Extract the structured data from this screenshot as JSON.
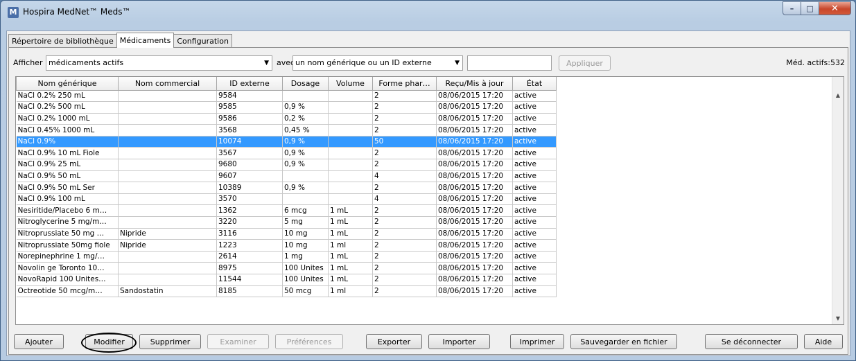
{
  "window": {
    "title": "Hospira MedNet™ Meds™",
    "app_icon": "M"
  },
  "window_controls": {
    "minimize_icon": "–",
    "maximize_icon": "□",
    "close_icon": "✕"
  },
  "tabs": [
    {
      "label": "Répertoire de bibliothèque"
    },
    {
      "label": "Médicaments"
    },
    {
      "label": "Configuration"
    }
  ],
  "filter": {
    "show_label": "Afficher",
    "show_value": "médicaments actifs",
    "with_label": "avec",
    "with_value": "un nom générique ou un ID externe",
    "search_value": "",
    "apply_label": "Appliquer",
    "active_count": "Méd. actifs:532"
  },
  "table": {
    "headers": [
      "Nom générique",
      "Nom commercial",
      "ID externe",
      "Dosage",
      "Volume",
      "Forme phar…",
      "Reçu/Mis à jour",
      "État"
    ],
    "rows": [
      [
        "NaCl 0.2%   250 mL",
        "",
        "9584",
        "",
        "",
        "2",
        "08/06/2015 17:20",
        "active"
      ],
      [
        "NaCl 0.2%   500 mL",
        "",
        "9585",
        "0,9 %",
        "",
        "2",
        "08/06/2015 17:20",
        "active"
      ],
      [
        "NaCl 0.2%   1000 mL",
        "",
        "9586",
        "0,2 %",
        "",
        "2",
        "08/06/2015 17:20",
        "active"
      ],
      [
        "NaCl 0.45%  1000 mL",
        "",
        "3568",
        "0,45 %",
        "",
        "2",
        "08/06/2015 17:20",
        "active"
      ],
      [
        "NaCl 0.9%",
        "",
        "10074",
        "0,9 %",
        "",
        "50",
        "08/06/2015 17:20",
        "active"
      ],
      [
        "NaCl 0.9%   10 mL Fiole",
        "",
        "3567",
        "0,9 %",
        "",
        "2",
        "08/06/2015 17:20",
        "active"
      ],
      [
        "NaCl 0.9%   25 mL",
        "",
        "9680",
        "0,9 %",
        "",
        "2",
        "08/06/2015 17:20",
        "active"
      ],
      [
        "NaCl 0.9%   50 mL",
        "",
        "9607",
        "",
        "",
        "4",
        "08/06/2015 17:20",
        "active"
      ],
      [
        "NaCl 0.9%   50 mL Ser",
        "",
        "10389",
        "0,9 %",
        "",
        "2",
        "08/06/2015 17:20",
        "active"
      ],
      [
        "NaCl 0.9%  100 mL",
        "",
        "3570",
        "",
        "",
        "4",
        "08/06/2015 17:20",
        "active"
      ],
      [
        "Nesiritide/Placebo 6 m…",
        "",
        "1362",
        "6 mcg",
        "1 mL",
        "2",
        "08/06/2015 17:20",
        "active"
      ],
      [
        "Nitroglycerine 5 mg/m…",
        "",
        "3220",
        "5 mg",
        "1 mL",
        "2",
        "08/06/2015 17:20",
        "active"
      ],
      [
        "Nitroprussiate 50 mg …",
        "Nipride",
        "3116",
        "10 mg",
        "1 mL",
        "2",
        "08/06/2015 17:20",
        "active"
      ],
      [
        "Nitroprussiate 50mg fiole",
        "Nipride",
        "1223",
        "10 mg",
        "1 ml",
        "2",
        "08/06/2015 17:20",
        "active"
      ],
      [
        "Norepinephrine 1 mg/…",
        "",
        "2614",
        "1 mg",
        "1 mL",
        "2",
        "08/06/2015 17:20",
        "active"
      ],
      [
        "Novolin ge Toronto 10…",
        "",
        "8975",
        "100 Unites",
        "1 mL",
        "2",
        "08/06/2015 17:20",
        "active"
      ],
      [
        "NovoRapid 100 Unites…",
        "",
        "11544",
        "100 Unites",
        "1 mL",
        "2",
        "08/06/2015 17:20",
        "active"
      ],
      [
        "Octreotide  50 mcg/m…",
        "Sandostatin",
        "8185",
        "50 mcg",
        "1 ml",
        "2",
        "08/06/2015 17:20",
        "active"
      ]
    ],
    "selected_row": 4
  },
  "scrollbar": {
    "up_icon": "▲",
    "down_icon": "▼"
  },
  "buttons": {
    "add": "Ajouter",
    "modify": "Modifier",
    "delete": "Supprimer",
    "examine": "Examiner",
    "preferences": "Préférences",
    "export": "Exporter",
    "import": "Importer",
    "print": "Imprimer",
    "save_to_file": "Sauvegarder en fichier",
    "logout": "Se déconnecter",
    "help": "Aide"
  }
}
